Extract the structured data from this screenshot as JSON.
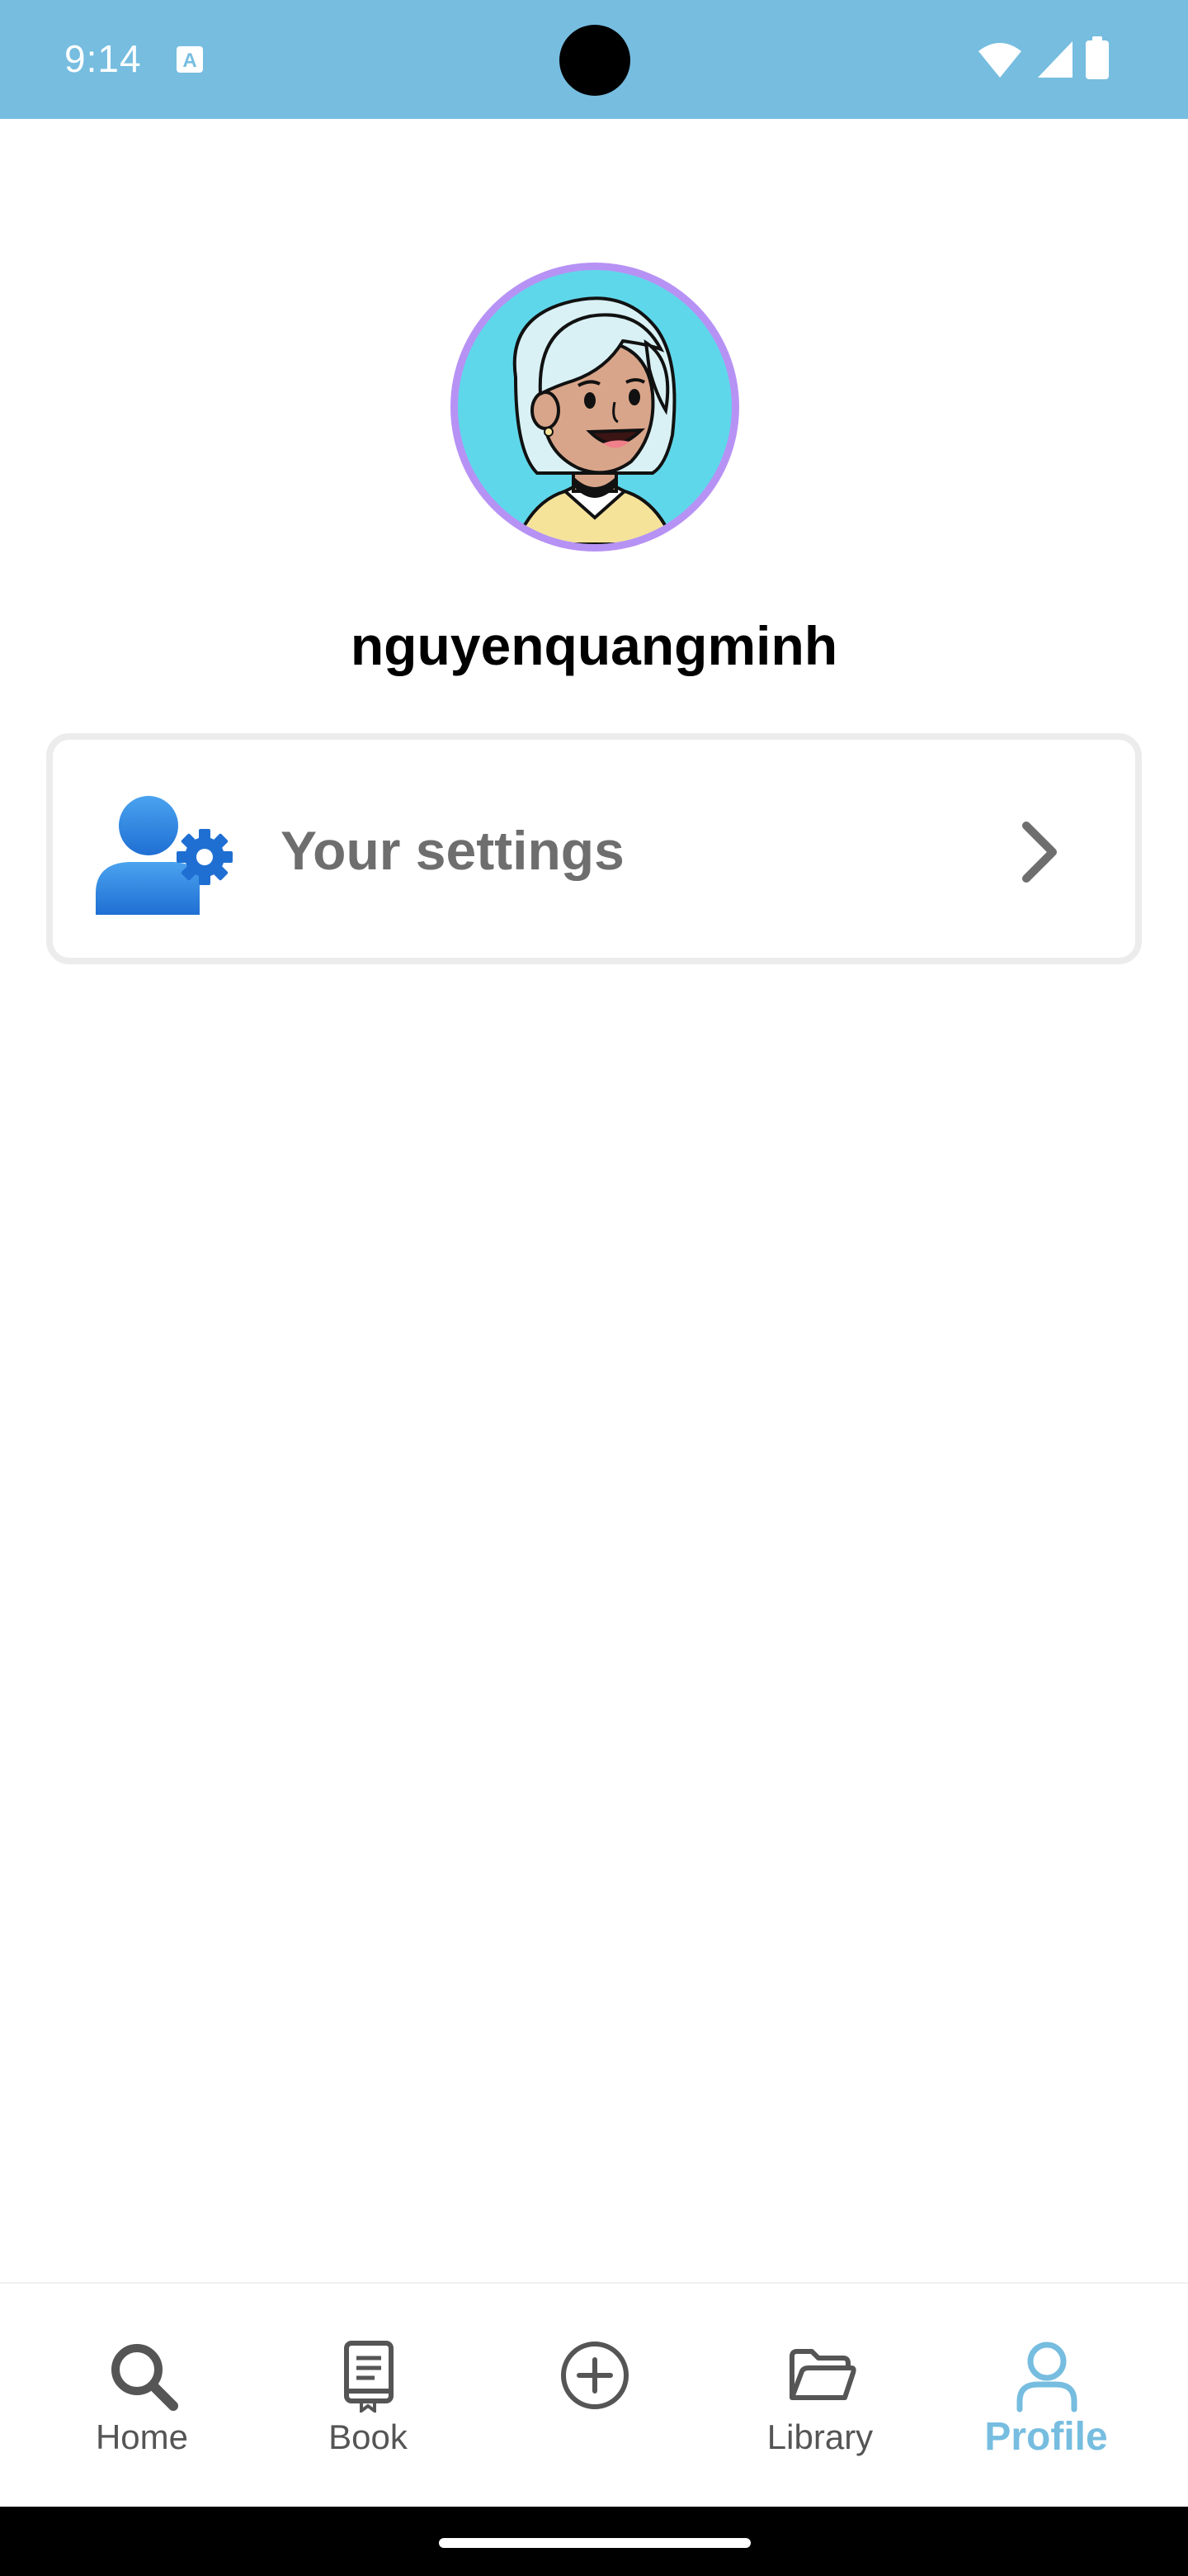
{
  "status_bar": {
    "time": "9:14",
    "background_color": "#76bde0",
    "icons": [
      "text-a-icon",
      "wifi-icon",
      "signal-icon",
      "battery-icon"
    ]
  },
  "profile": {
    "avatar_icon": "cartoon-woman-avatar",
    "avatar_ring_color": "#b792f5",
    "avatar_background_color": "#5fd7ea",
    "username": "nguyenquangminh"
  },
  "settings_card": {
    "icon": "user-gear-icon",
    "label": "Your settings",
    "chevron": "chevron-right-icon"
  },
  "bottom_nav": {
    "active_color": "#76bde0",
    "items": [
      {
        "label": "Home",
        "icon": "search-icon"
      },
      {
        "label": "Book",
        "icon": "book-icon"
      },
      {
        "label": "",
        "icon": "add-circle-icon"
      },
      {
        "label": "Library",
        "icon": "folder-icon"
      },
      {
        "label": "Profile",
        "icon": "person-icon",
        "active": true
      }
    ]
  }
}
